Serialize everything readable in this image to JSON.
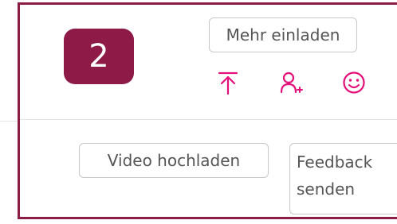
{
  "step": {
    "number": "2"
  },
  "toolbar": {
    "invite_label": "Mehr einladen",
    "icons": [
      "upload-icon",
      "add-person-icon",
      "smile-icon"
    ]
  },
  "actions": {
    "upload_video_label": "Video hochladen",
    "feedback_label": "Feedback senden"
  },
  "colors": {
    "highlight_frame": "#8b1c46",
    "step_badge": "#8e1a48",
    "accent_icon": "#e3107a",
    "button_border": "#c8c8c8",
    "button_text": "#555555"
  }
}
